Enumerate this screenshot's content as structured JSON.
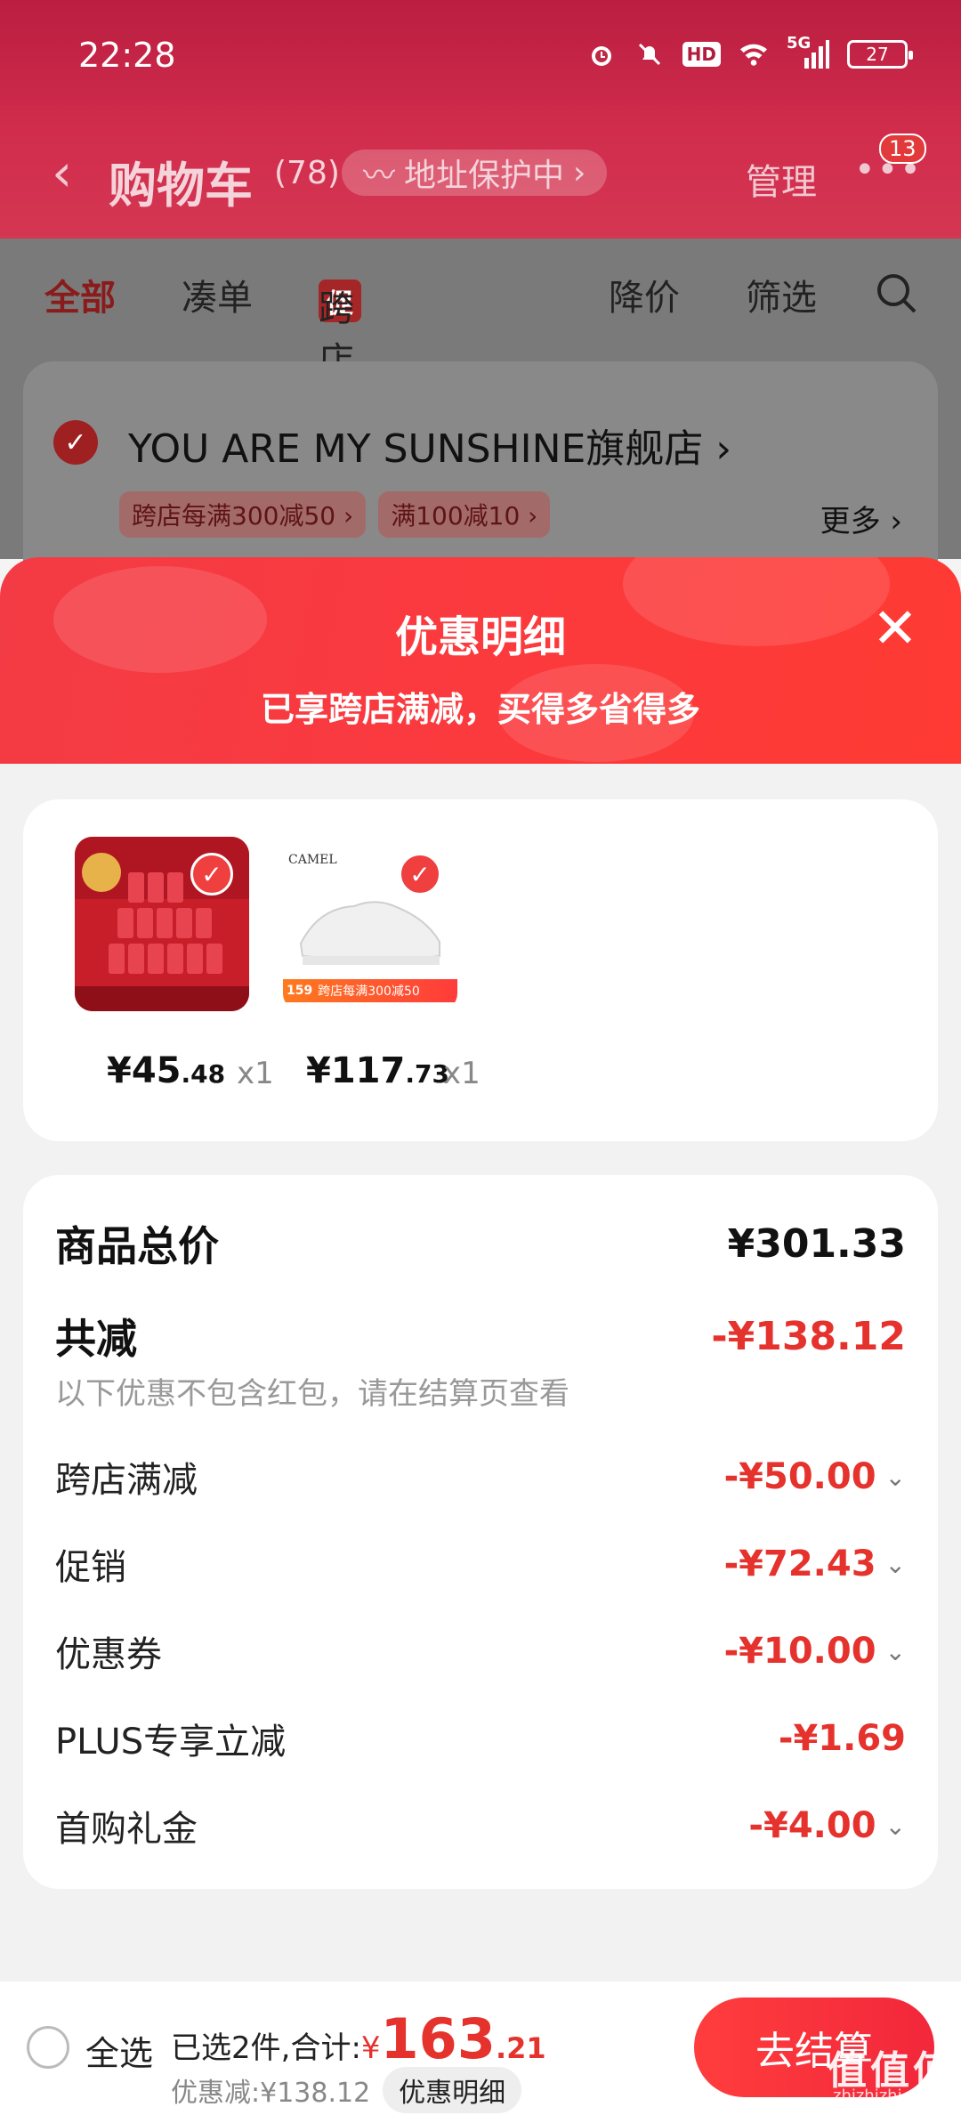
{
  "status_bar": {
    "time": "22:28",
    "hd": "HD",
    "network": "5G",
    "battery": "27"
  },
  "nav": {
    "title": "购物车",
    "count": "(78)",
    "address_pill": "地址保护中",
    "manage": "管理",
    "more_badge": "13"
  },
  "filter_tabs": [
    {
      "label": "全部"
    },
    {
      "label": "凑单"
    },
    {
      "label": "跨店满减",
      "tag": "促"
    },
    {
      "label": "降价"
    },
    {
      "label": "筛选"
    }
  ],
  "store": {
    "name": "YOU ARE MY SUNSHINE旗舰店",
    "tags": [
      "跨店每满300减50",
      "满100减10"
    ],
    "more": "更多"
  },
  "sheet": {
    "title": "优惠明细",
    "subtitle": "已享跨店满减，买得多省得多"
  },
  "products": [
    {
      "price_int": "¥45",
      "price_dec": ".48",
      "qty": "x1",
      "image": "cola-cans-gift-box"
    },
    {
      "price_int": "¥117",
      "price_dec": ".73",
      "qty": "x1",
      "image": "white-sneaker",
      "img_brand": "CAMEL",
      "img_price": "159",
      "img_promo": "跨店每满300减50"
    }
  ],
  "summary": {
    "total_label": "商品总价",
    "total_value": "¥301.33",
    "reduce_label": "共减",
    "reduce_value": "-¥138.12",
    "note": "以下优惠不包含红包，请在结算页查看",
    "items": [
      {
        "label": "跨店满减",
        "value": "-¥50.00",
        "expand": true
      },
      {
        "label": "促销",
        "value": "-¥72.43",
        "expand": true
      },
      {
        "label": "优惠券",
        "value": "-¥10.00",
        "expand": true
      },
      {
        "label": "PLUS专享立减",
        "value": "-¥1.69",
        "expand": false
      },
      {
        "label": "首购礼金",
        "value": "-¥4.00",
        "expand": true
      }
    ]
  },
  "bottom": {
    "select_all": "全选",
    "selected_text": "已选2件,合计:",
    "yen": "¥",
    "total_int": "163",
    "total_dec": ".21",
    "saved_text": "优惠减:¥138.12",
    "detail_pill": "优惠明细",
    "checkout": "去结算"
  },
  "watermark": {
    "text": "值值值",
    "sub": "zhizhizhi.com"
  },
  "colors": {
    "accent": "#e5322d",
    "header": "#c3253f",
    "sheet_head": "#fa3a3d"
  }
}
